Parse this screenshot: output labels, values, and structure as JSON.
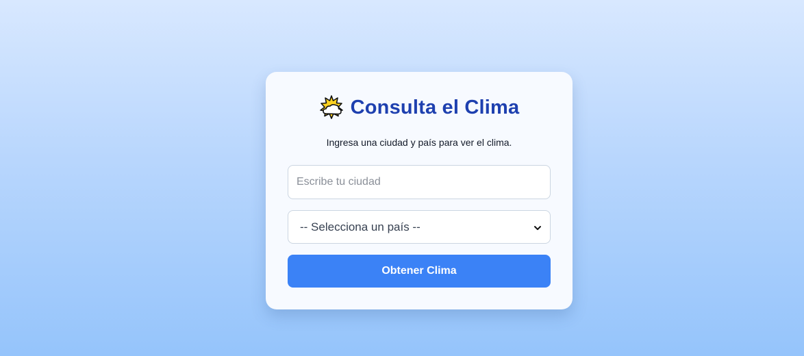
{
  "header": {
    "icon": "sun-behind-cloud-icon",
    "title": "Consulta el Clima",
    "subtitle": "Ingresa una ciudad y país para ver el clima."
  },
  "form": {
    "city_placeholder": "Escribe tu ciudad",
    "city_value": "",
    "country_selected": "-- Selecciona un país --",
    "submit_label": "Obtener Clima"
  },
  "colors": {
    "title": "#1e40af",
    "button": "#3b82f6",
    "background_top": "#d8e8ff",
    "background_bottom": "#95c4fb",
    "card": "#f7faff"
  }
}
